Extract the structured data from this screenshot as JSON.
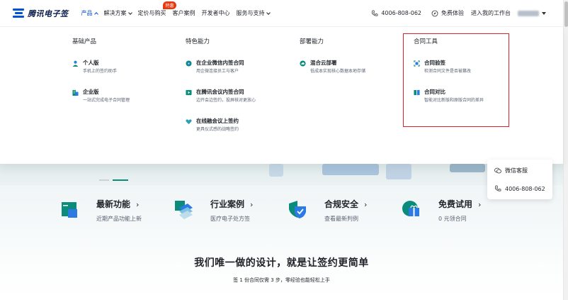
{
  "brand": {
    "name": "腾讯电子签",
    "color": "#0052d9"
  },
  "nav": {
    "items": [
      {
        "label": "产品",
        "active": true,
        "chevron": "up"
      },
      {
        "label": "解决方案",
        "chevron": "down"
      },
      {
        "label": "定价与购买",
        "badge": "特惠"
      },
      {
        "label": "客户案例"
      },
      {
        "label": "开发者中心"
      },
      {
        "label": "服务与支持",
        "chevron": "down"
      }
    ],
    "phone": "4006-808-062",
    "trial": "免费体验",
    "workbench": "进入我的工作台"
  },
  "dropdown": {
    "columns": [
      {
        "title": "基础产品",
        "items": [
          {
            "name": "个人版",
            "desc": "手机上的签约助手",
            "icon": "person-icon"
          },
          {
            "name": "企业版",
            "desc": "一站式完成电子合同管理",
            "icon": "building-icon"
          }
        ]
      },
      {
        "title": "特色能力",
        "items": [
          {
            "name": "在企业微信内签合同",
            "desc": "用企微连接员工与客户",
            "icon": "wecom-icon"
          },
          {
            "name": "在腾讯会议内签合同",
            "desc": "边开会边签约，投屏核对更放心",
            "icon": "meeting-icon"
          },
          {
            "name": "在线融会议上签约",
            "desc": "更具仪式感的战略签约",
            "icon": "heart-icon"
          }
        ]
      },
      {
        "title": "部署能力",
        "items": [
          {
            "name": "混合云部署",
            "desc": "低成本实现核心数据本地存储",
            "icon": "cloud-icon"
          }
        ]
      },
      {
        "title": "合同工具",
        "items": [
          {
            "name": "合同验签",
            "desc": "检测合同文件是否被篡改",
            "icon": "verify-icon"
          },
          {
            "name": "合同对比",
            "desc": "智能对比新版和原版合同的差异",
            "icon": "compare-icon"
          }
        ]
      }
    ]
  },
  "features": [
    {
      "title": "最新功能",
      "desc": "近期产品功能上新",
      "icon": "new-feature-icon"
    },
    {
      "title": "行业案例",
      "desc": "医疗电子处方签",
      "icon": "case-icon"
    },
    {
      "title": "合规安全",
      "desc": "查看最新判例",
      "icon": "shield-icon"
    },
    {
      "title": "免费试用",
      "desc": "0 元领合同",
      "icon": "gift-icon"
    }
  ],
  "slogan": {
    "title": "我们唯一做的设计，就是让签约更简单",
    "subtitle": "签 1 份合同仅需 3 步，零经验也能轻松上手"
  },
  "contact": {
    "wechat": "微信客服",
    "phone": "4006-808-062"
  },
  "colors": {
    "accent": "#0052d9",
    "teal": "#0b8c7a",
    "highlight": "#e0202b",
    "badge": "#e8380d"
  }
}
